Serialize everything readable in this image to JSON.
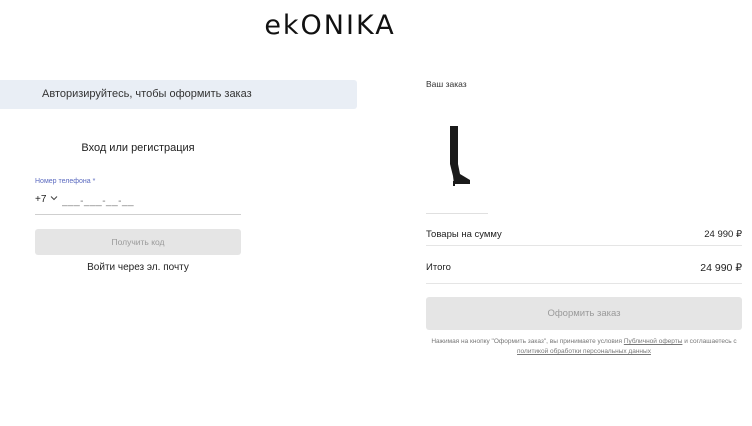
{
  "header": {
    "logo_text": "ekONIKA"
  },
  "auth": {
    "banner": "Авторизируйтесь, чтобы оформить заказ",
    "title": "Вход или регистрация",
    "phone_label": "Номер телефона *",
    "country_code": "+7",
    "phone_placeholder": "___-___-__-__",
    "get_code_button": "Получить код",
    "email_login_link": "Войти через эл. почту"
  },
  "order": {
    "title": "Ваш заказ",
    "product_icon": "boot-image",
    "subtotal_label": "Товары на сумму",
    "subtotal_value": "24 990 ₽",
    "total_label": "Итого",
    "total_value": "24 990 ₽",
    "checkout_button": "Оформить заказ",
    "terms_prefix": "Нажимая на кнопку \"Оформить заказ\", вы принимаете условия ",
    "terms_link_offer": "Публичной оферты",
    "terms_middle": " и соглашаетесь с ",
    "terms_link_privacy": "политикой обработки персональных данных"
  }
}
